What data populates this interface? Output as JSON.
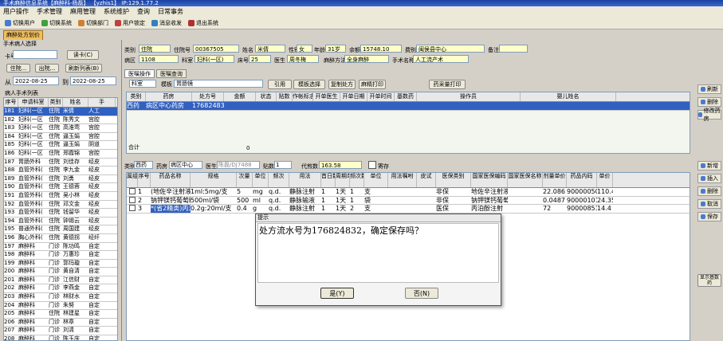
{
  "window": {
    "title": "手术麻醉信息系统【麻醉科-杨磊】  【yzhis1】 IP:129.1.77.2"
  },
  "menu": [
    "用户操作",
    "手术管理",
    "麻用管理",
    "系统维护",
    "查询",
    "日常事务"
  ],
  "toolbar": [
    {
      "label": "切换用户",
      "icon": "switch-user-icon",
      "color": "#4a7ad0"
    },
    {
      "label": "切换系统",
      "icon": "switch-system-icon",
      "color": "#40a040"
    },
    {
      "label": "切换部门",
      "icon": "switch-dept-icon",
      "color": "#d08030"
    },
    {
      "label": "用户锁定",
      "icon": "lock-icon",
      "color": "#c04040"
    },
    {
      "label": "消息收发",
      "icon": "message-icon",
      "color": "#3080c0"
    },
    {
      "label": "退出系统",
      "icon": "exit-icon",
      "color": "#b03030"
    }
  ],
  "doc_tab": "麻醉处方划价",
  "left": {
    "group_title": "手术病人选择",
    "card_label": "卡号",
    "read_card_btn": "读卡(C)",
    "btn_inhosp": "住院...",
    "btn_out": "出院...",
    "btn_refresh": "刷新列表(B)",
    "from_label": "从",
    "date_from": "2022-08-25",
    "to_label": "到",
    "date_to": "2022-08-25",
    "list_title": "病人手术列表",
    "columns": [
      "序号",
      "申请科室",
      "类别",
      "姓名",
      "手"
    ],
    "rows": [
      {
        "no": "181",
        "dept": "妇科(一区",
        "type": "住院",
        "name": "米倩",
        "op": "人工",
        "sel": true
      },
      {
        "no": "182",
        "dept": "妇科(一区",
        "type": "住院",
        "name": "陈秀文",
        "op": "宫腔"
      },
      {
        "no": "183",
        "dept": "妇科(一区",
        "type": "住院",
        "name": "高淮莺",
        "op": "宫腔"
      },
      {
        "no": "184",
        "dept": "妇科(一区",
        "type": "住院",
        "name": "逼玉娟",
        "op": "宫腔"
      },
      {
        "no": "185",
        "dept": "妇科(一区",
        "type": "住院",
        "name": "逼玉娟",
        "op": "阴道"
      },
      {
        "no": "186",
        "dept": "妇科(一区",
        "type": "住院",
        "name": "郑霞锦",
        "op": "宫腔"
      },
      {
        "no": "187",
        "dept": "胃肠外科",
        "type": "住院",
        "name": "刘佳存",
        "op": "经皮"
      },
      {
        "no": "188",
        "dept": "血管外科(",
        "type": "住院",
        "name": "李九金",
        "op": "经皮"
      },
      {
        "no": "189",
        "dept": "血管外科(",
        "type": "住院",
        "name": "刘勇",
        "op": "经皮"
      },
      {
        "no": "190",
        "dept": "血管外科(",
        "type": "住院",
        "name": "王德蓉",
        "op": "经皮"
      },
      {
        "no": "191",
        "dept": "血管外科(",
        "type": "住院",
        "name": "吴小林",
        "op": "经皮"
      },
      {
        "no": "192",
        "dept": "血管外科(",
        "type": "住院",
        "name": "邓文金",
        "op": "经皮"
      },
      {
        "no": "193",
        "dept": "血管外科(",
        "type": "住院",
        "name": "钱留华",
        "op": "经皮"
      },
      {
        "no": "194",
        "dept": "血管外科(",
        "type": "住院",
        "name": "钟锡云",
        "op": "经皮"
      },
      {
        "no": "195",
        "dept": "普通外科(",
        "type": "住院",
        "name": "周国建",
        "op": "经皮"
      },
      {
        "no": "196",
        "dept": "胸心外科(",
        "type": "住院",
        "name": "黄德拐",
        "op": "经纤"
      },
      {
        "no": "197",
        "dept": "麻醉科",
        "type": "门诊",
        "name": "陈功鸣",
        "op": "自定"
      },
      {
        "no": "198",
        "dept": "麻醉科",
        "type": "门诊",
        "name": "万惠珍",
        "op": "自定"
      },
      {
        "no": "199",
        "dept": "麻醉科",
        "type": "门诊",
        "name": "郭玛璇",
        "op": "自定"
      },
      {
        "no": "200",
        "dept": "麻醉科",
        "type": "门诊",
        "name": "黄自清",
        "op": "自定"
      },
      {
        "no": "201",
        "dept": "麻醉科",
        "type": "门诊",
        "name": "江信财",
        "op": "自定"
      },
      {
        "no": "202",
        "dept": "麻醉科",
        "type": "门诊",
        "name": "李燕金",
        "op": "自定"
      },
      {
        "no": "203",
        "dept": "麻醉科",
        "type": "门诊",
        "name": "林财水",
        "op": "自定"
      },
      {
        "no": "204",
        "dept": "麻醉科",
        "type": "门诊",
        "name": "朱努",
        "op": "自定"
      },
      {
        "no": "205",
        "dept": "麻醉科",
        "type": "住院",
        "name": "林建星",
        "op": "自定"
      },
      {
        "no": "206",
        "dept": "麻醉科",
        "type": "门诊",
        "name": "林章",
        "op": "自定"
      },
      {
        "no": "207",
        "dept": "麻醉科",
        "type": "门诊",
        "name": "刘清",
        "op": "自定"
      },
      {
        "no": "208",
        "dept": "麻醉科",
        "type": "门诊",
        "name": "陈玉庆",
        "op": "自定"
      }
    ]
  },
  "info": {
    "l_type": "类别",
    "v_type": "住院",
    "l_zyh": "住院号",
    "v_zyh": "00367505",
    "l_name": "姓名",
    "v_name": "米倩",
    "l_sex": "性别",
    "v_sex": "女",
    "l_age": "年龄",
    "v_age": "31岁",
    "l_fee": "余额",
    "v_fee": "15748.10",
    "l_feetype": "费别",
    "v_feetype": "闽侯县中心",
    "l_ward": "病区",
    "v_ward": "1108",
    "l_dept": "科室",
    "v_dept": "妇科(一区)",
    "l_bed": "床号",
    "v_bed": "25",
    "l_doctor": "医生",
    "v_doctor": "周冬梅",
    "l_method": "麻醉方法",
    "v_method": "全身麻醉",
    "l_opname": "手术名称",
    "v_opname": "人工流产术",
    "l_memo": "备注",
    "v_memo": ""
  },
  "tabs": [
    "医嘱操作",
    "医嘱查询"
  ],
  "order_bar": {
    "dept_sel": "科室",
    "template_label": "模板",
    "template_val": "胃肠镜",
    "btn_use": "引用",
    "btn_template": "模板选择",
    "btn_copy": "复制处方",
    "btn_print": "麻精打印",
    "btn_print_all": "药采量打印"
  },
  "upper_table": {
    "columns": [
      "类别",
      "药房",
      "处方号",
      "金额",
      "状态",
      "贴数",
      "作帐标志",
      "开单医生",
      "开单日期",
      "开单时间",
      "基数药",
      "操作员",
      "婴儿姓名"
    ],
    "row": {
      "type": "西药",
      "pharmacy": "病区中心药房",
      "rx": "176824832"
    },
    "total_label": "合计",
    "total": "0"
  },
  "side_buttons_top": [
    {
      "label": "刷新",
      "icon": "refresh-icon"
    },
    {
      "label": "删除",
      "icon": "delete-icon"
    },
    {
      "label": "修改药房",
      "icon": "edit-pharmacy-icon"
    }
  ],
  "side_buttons_bottom": [
    {
      "label": "新增",
      "icon": "new-icon"
    },
    {
      "label": "插入",
      "icon": "insert-icon"
    },
    {
      "label": "删除",
      "icon": "delete-icon"
    },
    {
      "label": "取消",
      "icon": "cancel-icon"
    },
    {
      "label": "保存",
      "icon": "save-icon"
    }
  ],
  "side_extra": "显示基数药",
  "rx_bar": {
    "l_type": "类别",
    "v_type": "西药",
    "l_pharm": "药房",
    "v_pharm": "病区中心",
    "l_doc": "医生",
    "v_doc": "陈磊",
    "v_code": "DJ7488",
    "l_tie": "贴数",
    "v_tie": "1",
    "l_dai": "代煎数",
    "v_dai": "163.58",
    "chk_label": "寄存"
  },
  "lower_table": {
    "columns": [
      "属组",
      "序号",
      "药品名称",
      "规格",
      "次量",
      "单位",
      "频次",
      "用法",
      "首日数量",
      "周期单位",
      "频次数量",
      "单位",
      "用法嘱咐",
      "皮试",
      "医保类别",
      "国家医保编码",
      "国家医保名称",
      "剂量单价",
      "药品内码",
      "单价"
    ],
    "rows": [
      {
        "no": "1",
        "name": "(地佐辛注射液",
        "spec": "1ml:5mg/支",
        "dose": "5",
        "unit": "mg",
        "freq": "q.d.",
        "usage": "静脉注射",
        "d1": "1",
        "period": "1天",
        "n": "1",
        "u2": "支",
        "ins": "非保",
        "code": "地佐辛注射液",
        "price": "22.086",
        "inner": "9000005053",
        "uprice": "110.43"
      },
      {
        "no": "2",
        "name": "钠钾镁钙葡萄糖注射液",
        "spec": "500ml/袋",
        "dose": "500",
        "unit": "ml",
        "freq": "q.d.",
        "usage": "静脉输液",
        "d1": "1",
        "period": "1天",
        "n": "1",
        "u2": "袋",
        "ins": "非保",
        "code": "钠钾镁钙葡萄",
        "price": "0.0487",
        "inner": "9000010104",
        "uprice": "24.35"
      },
      {
        "no": "3",
        "name": "*(省2精类)丙泊酚",
        "spec": "0.2g:20ml/支",
        "dose": "0.4",
        "unit": "g",
        "freq": "q.d.",
        "usage": "静脉注射",
        "d1": "1",
        "period": "1天",
        "n": "2",
        "u2": "支",
        "ins": "医保",
        "code": "丙泊酚注射",
        "price": "72",
        "inner": "9000085133",
        "uprice": "14.4"
      }
    ]
  },
  "dialog": {
    "title": "提示",
    "message": "处方流水号为176824832，确定保存吗？",
    "yes": "是(Y)",
    "no": "否(N)"
  }
}
